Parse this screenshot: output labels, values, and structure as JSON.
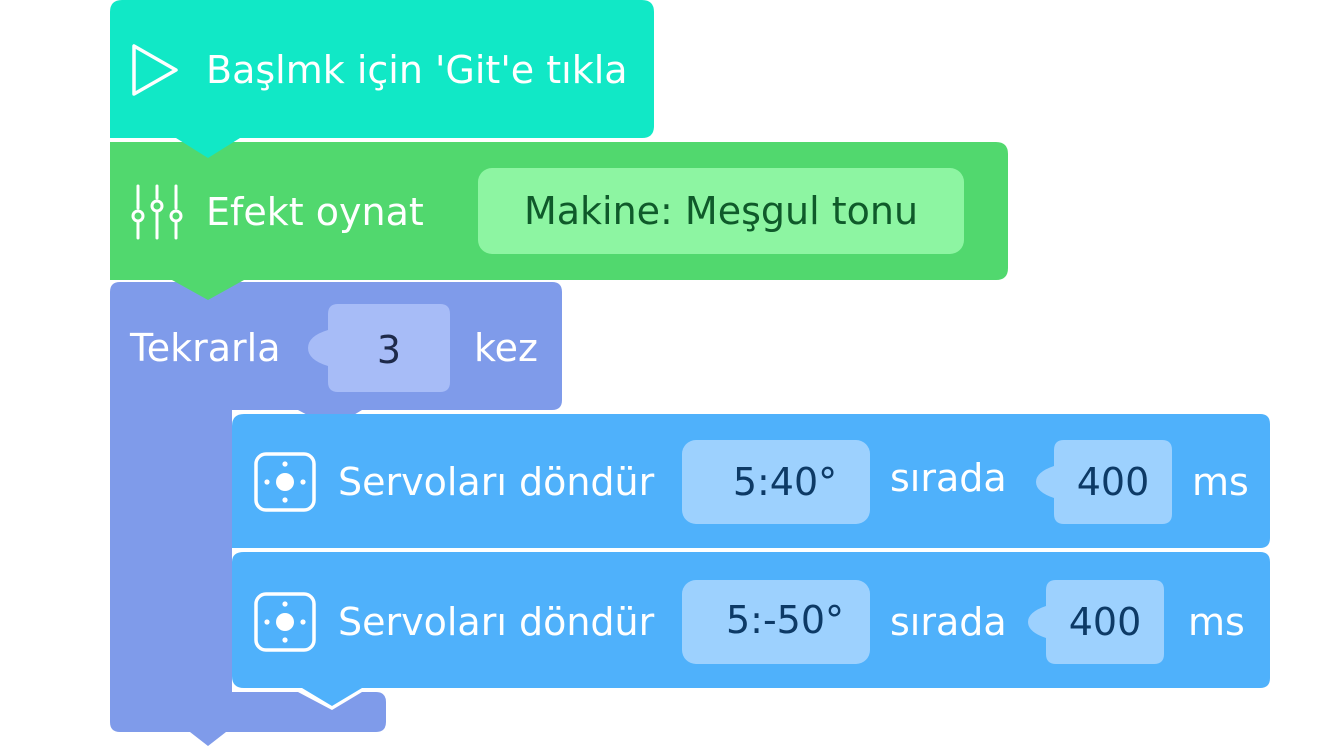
{
  "start_block": {
    "label": "Başlmk için 'Git'e tıkla",
    "icon": "play-icon",
    "color": "#11E8C6"
  },
  "effect_block": {
    "label": "Efekt oynat",
    "icon": "sliders-icon",
    "value": "Makine: Meşgul tonu",
    "color": "#51D86E",
    "slot_color": "#8DF5A2",
    "slot_text_color": "#0F5A2A"
  },
  "repeat_block": {
    "label": "Tekrarla",
    "count": "3",
    "suffix": "kez",
    "color": "#7F9BEA",
    "slot_color": "#A7BCF7",
    "slot_text_color": "#1E2A4A"
  },
  "servo_blocks": [
    {
      "label": "Servoları döndür",
      "icon": "servo-icon",
      "angle": "5:40°",
      "middle": "sırada",
      "duration": "400",
      "unit": "ms"
    },
    {
      "label": "Servoları döndür",
      "icon": "servo-icon",
      "angle": "5:-50°",
      "middle": "sırada",
      "duration": "400",
      "unit": "ms"
    }
  ],
  "servo_color": "#4FB1FB",
  "servo_slot_color": "#9DD1FE",
  "servo_slot_text_color": "#0D3A66"
}
